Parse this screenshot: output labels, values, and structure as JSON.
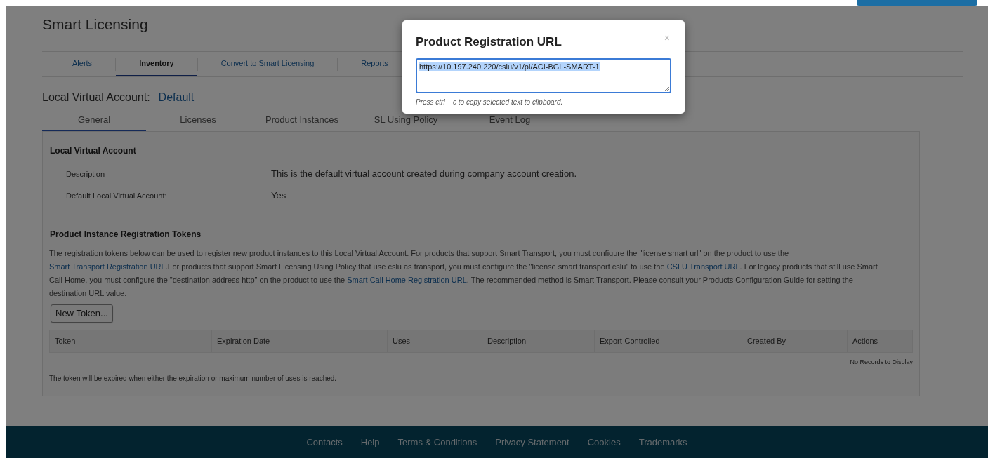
{
  "header_title": "Smart Licensing",
  "nav_tabs": [
    {
      "label": "Alerts",
      "selected": false
    },
    {
      "label": "Inventory",
      "selected": true
    },
    {
      "label": "Convert to Smart Licensing",
      "selected": false
    },
    {
      "label": "Reports",
      "selected": false
    }
  ],
  "account": {
    "label": "Local Virtual Account:",
    "value": "Default"
  },
  "sub_tabs": [
    {
      "label": "General",
      "selected": true
    },
    {
      "label": "Licenses",
      "selected": false
    },
    {
      "label": "Product Instances",
      "selected": false
    },
    {
      "label": "SL Using Policy",
      "selected": false
    },
    {
      "label": "Event Log",
      "selected": false
    }
  ],
  "account_section": {
    "title": "Local Virtual Account",
    "fields": [
      {
        "label": "Description",
        "value": "This is the default virtual account created during company account creation."
      },
      {
        "label": "Default Local Virtual Account:",
        "value": "Yes"
      }
    ]
  },
  "tokens_section": {
    "title": "Product Instance Registration Tokens",
    "description": [
      {
        "kind": "text",
        "text": "The registration tokens below can be used to register new product instances to this Local Virtual Account. For products that support Smart Transport, you must configure the \"license smart url\" on the product to use the "
      },
      {
        "kind": "link",
        "text": "Smart Transport Registration URL"
      },
      {
        "kind": "text",
        "text": ".For products that support Smart Licensing Using Policy that use cslu as transport, you must configure the \"license smart transport cslu\" to use the "
      },
      {
        "kind": "link",
        "text": "CSLU Transport URL"
      },
      {
        "kind": "text",
        "text": ". For legacy products that still use Smart Call Home, you must configure the \"destination address http\" on the product to use the "
      },
      {
        "kind": "link",
        "text": "Smart Call Home Registration URL"
      },
      {
        "kind": "text",
        "text": ". The recommended method is Smart Transport. Please consult your Products Configuration Guide for setting the destination URL value."
      }
    ],
    "button": "New Token...",
    "table": {
      "columns": [
        "Token",
        "Expiration Date",
        "Uses",
        "Description",
        "Export-Controlled",
        "Created By",
        "Actions"
      ],
      "empty_message": "No Records to Display"
    },
    "note": "The token will be expired when either the expiration or maximum number of uses is reached."
  },
  "footer_links": [
    "Contacts",
    "Help",
    "Terms & Conditions",
    "Privacy Statement",
    "Cookies",
    "Trademarks"
  ],
  "modal": {
    "title": "Product Registration URL",
    "close": "×",
    "url": "https://10.197.240.220/cslu/v1/pi/ACI-BGL-SMART-1",
    "url_selected": true,
    "hint": "Press ctrl + c to copy selected text to clipboard."
  }
}
